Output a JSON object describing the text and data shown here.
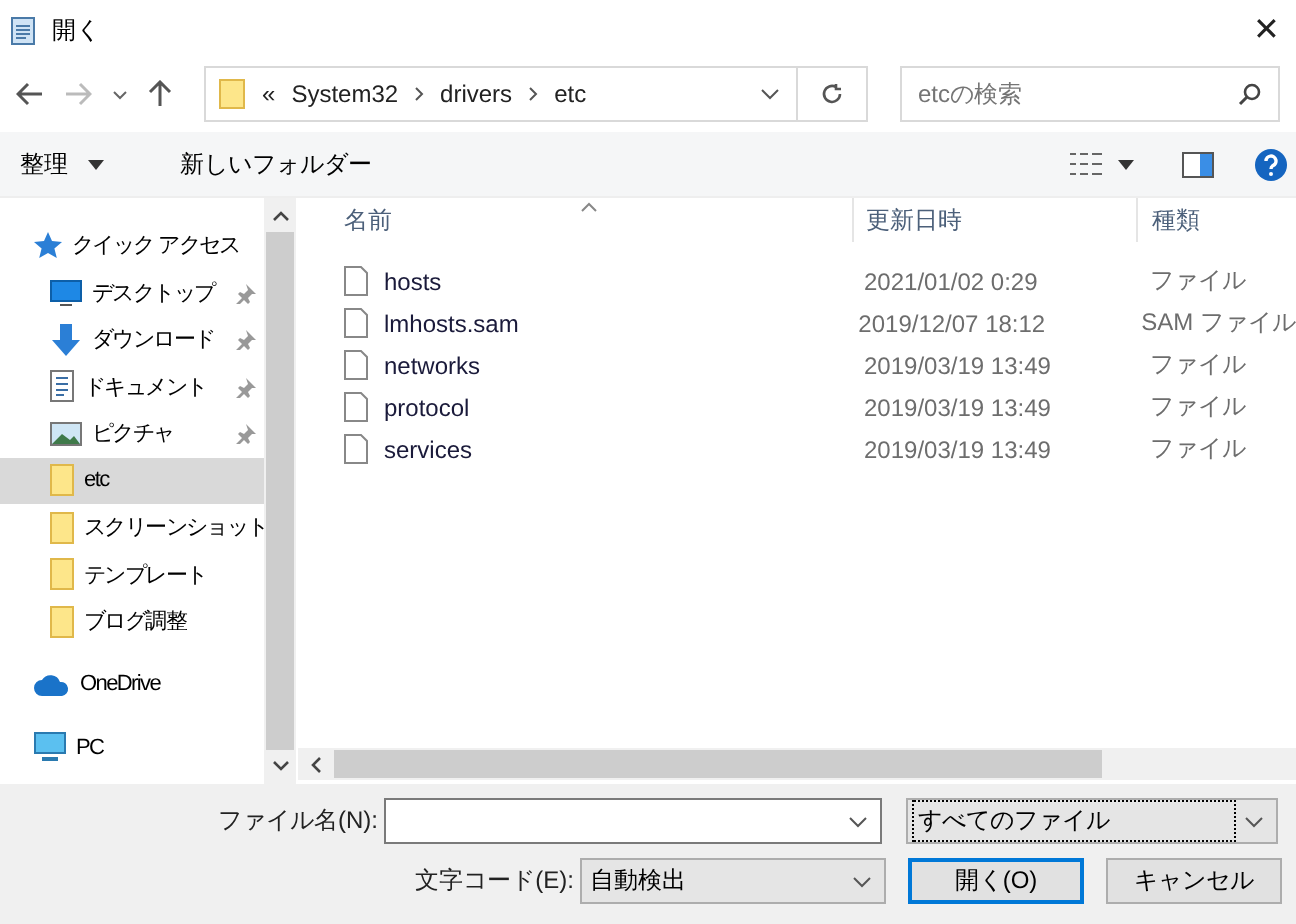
{
  "window": {
    "title": "開く",
    "close": "✕"
  },
  "address": {
    "overflow": "«",
    "crumbs": [
      "System32",
      "drivers",
      "etc"
    ]
  },
  "search": {
    "placeholder": "etcの検索"
  },
  "toolbar": {
    "organize": "整理",
    "new_folder": "新しいフォルダー"
  },
  "sidebar": {
    "items": [
      {
        "kind": "quick",
        "label": "クイック アクセス",
        "pinned": false,
        "selected": false
      },
      {
        "kind": "desktop",
        "label": "デスクトップ",
        "pinned": true,
        "selected": false
      },
      {
        "kind": "download",
        "label": "ダウンロード",
        "pinned": true,
        "selected": false
      },
      {
        "kind": "document",
        "label": "ドキュメント",
        "pinned": true,
        "selected": false
      },
      {
        "kind": "pictures",
        "label": "ピクチャ",
        "pinned": true,
        "selected": false
      },
      {
        "kind": "folder",
        "label": "etc",
        "pinned": false,
        "selected": true
      },
      {
        "kind": "folder",
        "label": "スクリーンショット",
        "pinned": false,
        "selected": false
      },
      {
        "kind": "folder",
        "label": "テンプレート",
        "pinned": false,
        "selected": false
      },
      {
        "kind": "folder",
        "label": "ブログ調整",
        "pinned": false,
        "selected": false
      },
      {
        "kind": "cloud",
        "label": "OneDrive",
        "pinned": false,
        "selected": false
      },
      {
        "kind": "pc",
        "label": "PC",
        "pinned": false,
        "selected": false
      }
    ]
  },
  "table": {
    "columns": [
      "名前",
      "更新日時",
      "種類"
    ],
    "rows": [
      {
        "name": "hosts",
        "modified": "2021/01/02 0:29",
        "type": "ファイル"
      },
      {
        "name": "lmhosts.sam",
        "modified": "2019/12/07 18:12",
        "type": "SAM ファイル"
      },
      {
        "name": "networks",
        "modified": "2019/03/19 13:49",
        "type": "ファイル"
      },
      {
        "name": "protocol",
        "modified": "2019/03/19 13:49",
        "type": "ファイル"
      },
      {
        "name": "services",
        "modified": "2019/03/19 13:49",
        "type": "ファイル"
      }
    ]
  },
  "footer": {
    "filename_label": "ファイル名(N):",
    "filter": "すべてのファイル",
    "encoding_label": "文字コード(E):",
    "encoding": "自動検出",
    "open": "開く(O)",
    "cancel": "キャンセル"
  }
}
